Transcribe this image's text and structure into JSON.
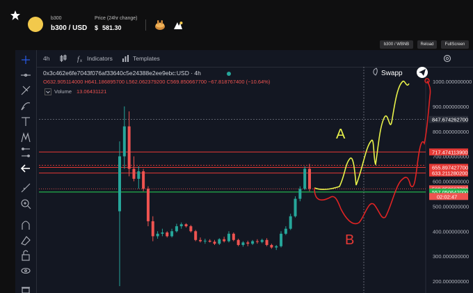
{
  "header": {
    "token_name": "b300",
    "pair": "b300 / USD",
    "price_label": "Price (24hr change)",
    "price_currency": "$",
    "price_value": "581.30"
  },
  "buttons": {
    "pair_label": "b300 / WBNB",
    "reload_label": "Reload",
    "fullscreen_label": "FullScreen"
  },
  "toolbar": {
    "interval": "4h",
    "indicators_label": "Indicators",
    "templates_label": "Templates"
  },
  "legend": {
    "symbol": "0x3c462e6fe7043f076af33640c5e24388e2ee9ebc:USD · 4h",
    "ohlc": "O632.905114000 H641.186895700 L562.062379200 C569.850667700 −67.818767400 (−10.64%)",
    "volume_label": "Volume",
    "volume_value": "13.06431121"
  },
  "watermark": "Swapp",
  "annotations": {
    "a": "A",
    "b": "B"
  },
  "colors": {
    "up": "#26a69a",
    "down": "#ef5350",
    "bg": "#131722",
    "yellow_path": "#e8f24a",
    "red_path": "#e02424"
  },
  "chart_data": {
    "type": "candlestick",
    "y_axis_ticks": [
      "1000.000000000",
      "900.000000000",
      "800.000000000",
      "700.000000000",
      "600.000000000",
      "500.000000000",
      "400.000000000",
      "300.000000000",
      "200.000000000"
    ],
    "ylim": [
      180,
      1030
    ],
    "price_tags": [
      {
        "value": 847.6742627,
        "label": "847.674262700",
        "color": "#2a2e39"
      },
      {
        "value": 717.4741139,
        "label": "717.474113900",
        "color": "#e53935"
      },
      {
        "value": 655.8974277,
        "label": "655.897427700",
        "color": "#e53935"
      },
      {
        "value": 633.2112802,
        "label": "633.211280200",
        "color": "#e53935"
      },
      {
        "value": 569.8506677,
        "label": "569.850667700",
        "color": "#ef5350"
      },
      {
        "value": 557.050642,
        "label": "557.050642000",
        "color": "#22b14c"
      }
    ],
    "countdown": "02:02:47",
    "candles": [
      {
        "o": 480,
        "h": 760,
        "l": 180,
        "c": 700
      },
      {
        "o": 700,
        "h": 900,
        "l": 650,
        "c": 820
      },
      {
        "o": 820,
        "h": 880,
        "l": 620,
        "c": 650
      },
      {
        "o": 650,
        "h": 700,
        "l": 600,
        "c": 610
      },
      {
        "o": 610,
        "h": 660,
        "l": 570,
        "c": 640
      },
      {
        "o": 640,
        "h": 650,
        "l": 560,
        "c": 570
      },
      {
        "o": 570,
        "h": 580,
        "l": 420,
        "c": 440
      },
      {
        "o": 440,
        "h": 460,
        "l": 360,
        "c": 380
      },
      {
        "o": 380,
        "h": 400,
        "l": 370,
        "c": 390
      },
      {
        "o": 390,
        "h": 410,
        "l": 380,
        "c": 395
      },
      {
        "o": 395,
        "h": 400,
        "l": 375,
        "c": 380
      },
      {
        "o": 380,
        "h": 410,
        "l": 375,
        "c": 400
      },
      {
        "o": 400,
        "h": 430,
        "l": 395,
        "c": 420
      },
      {
        "o": 420,
        "h": 435,
        "l": 410,
        "c": 428
      },
      {
        "o": 428,
        "h": 432,
        "l": 415,
        "c": 420
      },
      {
        "o": 420,
        "h": 425,
        "l": 395,
        "c": 400
      },
      {
        "o": 400,
        "h": 405,
        "l": 360,
        "c": 365
      },
      {
        "o": 365,
        "h": 375,
        "l": 355,
        "c": 360
      },
      {
        "o": 360,
        "h": 370,
        "l": 350,
        "c": 362
      },
      {
        "o": 362,
        "h": 368,
        "l": 355,
        "c": 358
      },
      {
        "o": 358,
        "h": 365,
        "l": 345,
        "c": 350
      },
      {
        "o": 350,
        "h": 372,
        "l": 345,
        "c": 368
      },
      {
        "o": 368,
        "h": 378,
        "l": 355,
        "c": 360
      },
      {
        "o": 360,
        "h": 400,
        "l": 355,
        "c": 390
      },
      {
        "o": 390,
        "h": 395,
        "l": 360,
        "c": 365
      },
      {
        "o": 365,
        "h": 370,
        "l": 340,
        "c": 345
      },
      {
        "o": 345,
        "h": 360,
        "l": 338,
        "c": 355
      },
      {
        "o": 355,
        "h": 362,
        "l": 340,
        "c": 350
      },
      {
        "o": 350,
        "h": 365,
        "l": 345,
        "c": 360
      },
      {
        "o": 360,
        "h": 368,
        "l": 350,
        "c": 357
      },
      {
        "o": 357,
        "h": 370,
        "l": 352,
        "c": 365
      },
      {
        "o": 365,
        "h": 372,
        "l": 340,
        "c": 345
      },
      {
        "o": 345,
        "h": 350,
        "l": 330,
        "c": 335
      },
      {
        "o": 335,
        "h": 345,
        "l": 325,
        "c": 340
      },
      {
        "o": 340,
        "h": 400,
        "l": 335,
        "c": 390
      },
      {
        "o": 390,
        "h": 420,
        "l": 385,
        "c": 410
      },
      {
        "o": 410,
        "h": 470,
        "l": 405,
        "c": 460
      },
      {
        "o": 460,
        "h": 540,
        "l": 455,
        "c": 530
      },
      {
        "o": 530,
        "h": 580,
        "l": 520,
        "c": 570
      },
      {
        "o": 570,
        "h": 660,
        "l": 565,
        "c": 650
      },
      {
        "o": 650,
        "h": 670,
        "l": 560,
        "c": 570
      }
    ]
  }
}
